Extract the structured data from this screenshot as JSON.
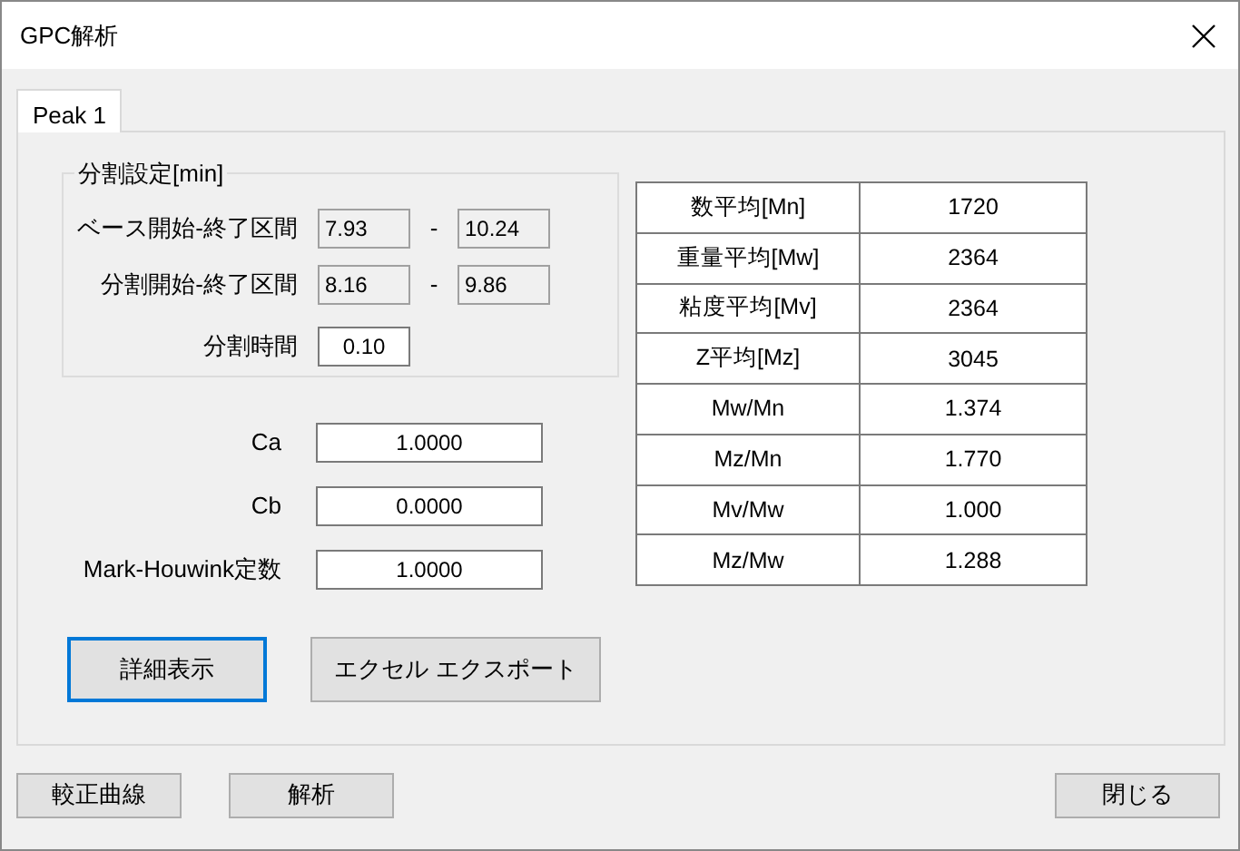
{
  "window": {
    "title": "GPC解析"
  },
  "tabs": [
    {
      "label": "Peak 1",
      "selected": true
    }
  ],
  "split_settings": {
    "title": "分割設定[min]",
    "ranges": [
      {
        "label": "ベース開始-終了区間",
        "separator": "-",
        "from": {
          "value": "7.93",
          "readonly": true
        },
        "to": {
          "value": "10.24",
          "readonly": true
        }
      },
      {
        "label": "分割開始-終了区間",
        "separator": "-",
        "from": {
          "value": "8.16",
          "readonly": true
        },
        "to": {
          "value": "9.86",
          "readonly": true
        }
      }
    ],
    "split_time": {
      "label": "分割時間",
      "value": "0.10",
      "readonly": false
    }
  },
  "params": [
    {
      "label": "Ca",
      "value": "1.0000"
    },
    {
      "label": "Cb",
      "value": "0.0000"
    },
    {
      "label": "Mark-Houwink定数",
      "value": "1.0000"
    }
  ],
  "stats": [
    {
      "label": "数平均[Mn]",
      "value": "1720"
    },
    {
      "label": "重量平均[Mw]",
      "value": "2364"
    },
    {
      "label": "粘度平均[Mv]",
      "value": "2364"
    },
    {
      "label": "Z平均[Mz]",
      "value": "3045"
    },
    {
      "label": "Mw/Mn",
      "value": "1.374"
    },
    {
      "label": "Mz/Mn",
      "value": "1.770"
    },
    {
      "label": "Mv/Mw",
      "value": "1.000"
    },
    {
      "label": "Mz/Mw",
      "value": "1.288"
    }
  ],
  "actions": [
    {
      "label": "詳細表示",
      "focused": true
    },
    {
      "label": "エクセル エクスポート",
      "focused": false
    }
  ],
  "footer": {
    "left_buttons": [
      "較正曲線",
      "解析"
    ],
    "right_buttons": [
      "閉じる"
    ]
  }
}
